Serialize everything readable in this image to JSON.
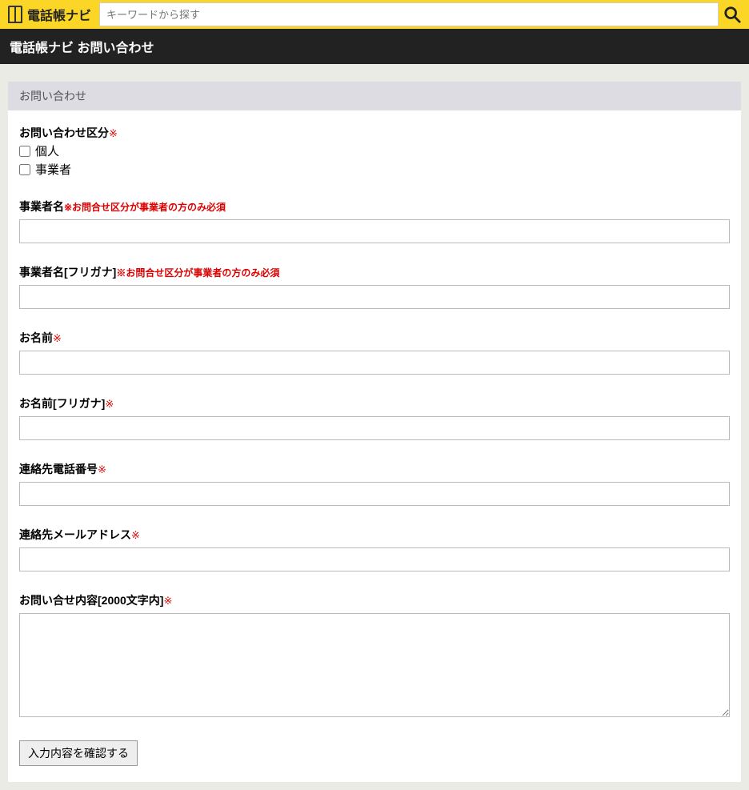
{
  "header": {
    "site_name": "電話帳ナビ",
    "search_placeholder": "キーワードから探す"
  },
  "title_bar": "電話帳ナビ お問い合わせ",
  "section_header": "お問い合わせ",
  "required_mark": "※",
  "form": {
    "category": {
      "label": "お問い合わせ区分",
      "option_personal": "個人",
      "option_business": "事業者"
    },
    "company_name": {
      "label": "事業者名",
      "note": "※お問合せ区分が事業者の方のみ必須",
      "value": ""
    },
    "company_name_kana": {
      "label": "事業者名[フリガナ]",
      "note": "※お問合せ区分が事業者の方のみ必須",
      "value": ""
    },
    "name": {
      "label": "お名前",
      "value": ""
    },
    "name_kana": {
      "label": "お名前[フリガナ]",
      "value": ""
    },
    "phone": {
      "label": "連絡先電話番号",
      "value": ""
    },
    "email": {
      "label": "連絡先メールアドレス",
      "value": ""
    },
    "content": {
      "label": "お問い合せ内容[2000文字内]",
      "value": ""
    },
    "submit_label": "入力内容を確認する"
  }
}
